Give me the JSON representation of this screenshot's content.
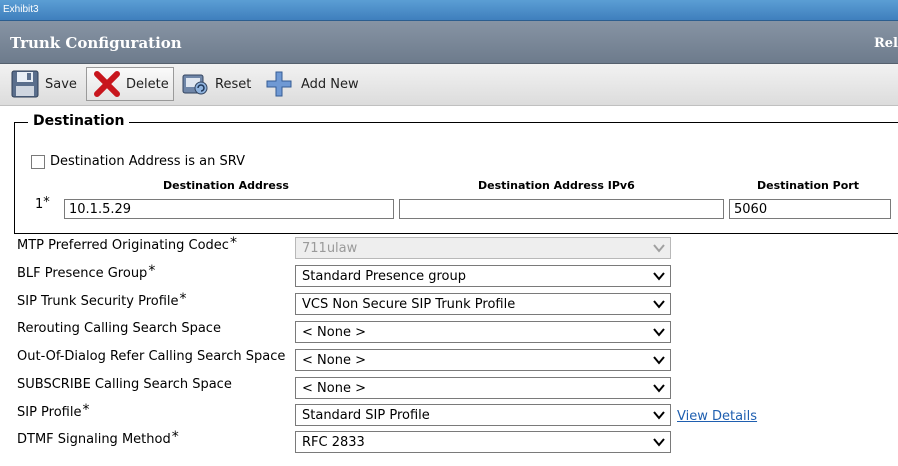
{
  "window": {
    "title": "Exhibit3"
  },
  "header": {
    "title": "Trunk Configuration",
    "right_text": "Rel"
  },
  "toolbar": {
    "save": "Save",
    "delete": "Delete",
    "reset": "Reset",
    "add_new": "Add New"
  },
  "destination": {
    "legend": "Destination",
    "srv_label": "Destination Address is an SRV",
    "srv_checked": false,
    "col_address": "Destination Address",
    "col_ipv6": "Destination Address IPv6",
    "col_port": "Destination Port",
    "row_number": "1",
    "address_value": "10.1.5.29",
    "ipv6_value": "",
    "port_value": "5060"
  },
  "fields": {
    "mtp_codec": {
      "label": "MTP Preferred Originating Codec",
      "value": "711ulaw"
    },
    "blf_group": {
      "label": "BLF Presence Group",
      "value": "Standard Presence group"
    },
    "sip_security": {
      "label": "SIP Trunk Security Profile",
      "value": "VCS Non Secure SIP Trunk Profile"
    },
    "rerouting_css": {
      "label": "Rerouting Calling Search Space",
      "value": "< None >"
    },
    "ood_refer_css": {
      "label": "Out-Of-Dialog Refer Calling Search Space",
      "value": "< None >"
    },
    "subscribe_css": {
      "label": "SUBSCRIBE Calling Search Space",
      "value": "< None >"
    },
    "sip_profile": {
      "label": "SIP Profile",
      "value": "Standard SIP Profile",
      "link": "View Details"
    },
    "dtmf": {
      "label": "DTMF Signaling Method",
      "value": "RFC 2833"
    }
  },
  "required_marker": "*"
}
